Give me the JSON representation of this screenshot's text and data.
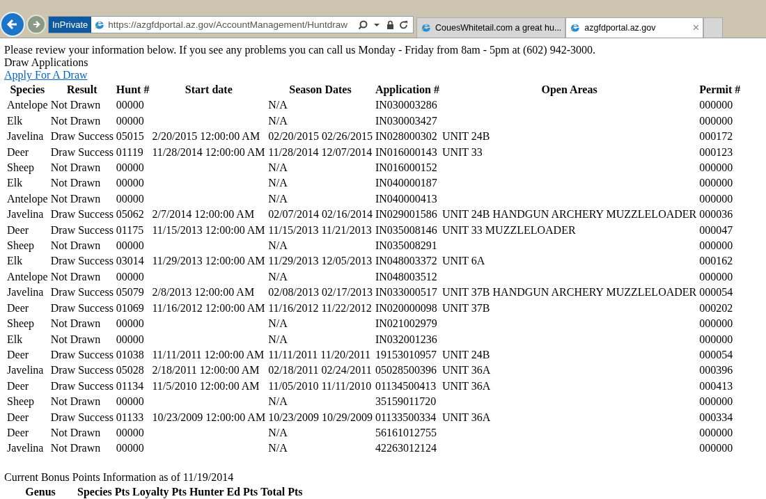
{
  "browser": {
    "private_badge": "InPrivate",
    "address": "https://azgfdportal.az.gov/AccountManagement/Huntdraw",
    "tabs": [
      {
        "title": "CouesWhitetail.com a great hu...",
        "selected": false
      },
      {
        "title": "azgfdportal.az.gov",
        "selected": true,
        "close": "×"
      }
    ]
  },
  "page": {
    "notice": "Please review your information below. If you see any problems you can call us Monday - Friday from 8am - 5pm at (602) 942-3000.",
    "heading": "Draw Applications",
    "link": "Apply For A Draw",
    "table": {
      "columns": [
        "Species",
        "Result",
        "Hunt #",
        "Start date",
        "Season Dates",
        "Application #",
        "Open Areas",
        "Permit #"
      ],
      "rows": [
        {
          "species": "Antelope",
          "result": "Not Drawn",
          "hunt": "00000",
          "season_dates": "N/A",
          "application": "IN030003286",
          "permit": "000000"
        },
        {
          "species": "Elk",
          "result": "Not Drawn",
          "hunt": "00000",
          "season_dates": "N/A",
          "application": "IN030003427",
          "permit": "000000"
        },
        {
          "species": "Javelina",
          "result": "Draw Success",
          "hunt": "05015",
          "start_date": "2/20/2015 12:00:00 AM",
          "season_dates": "02/20/2015 02/26/2015",
          "application": "IN028000302",
          "open_areas": "UNIT 24B",
          "permit": "000172"
        },
        {
          "species": "Deer",
          "result": "Draw Success",
          "hunt": "01119",
          "start_date": "11/28/2014 12:00:00 AM",
          "season_dates": "11/28/2014 12/07/2014",
          "application": "IN016000143",
          "open_areas": "UNIT 33",
          "permit": "000123"
        },
        {
          "species": "Sheep",
          "result": "Not Drawn",
          "hunt": "00000",
          "season_dates": "N/A",
          "application": "IN016000152",
          "permit": "000000"
        },
        {
          "species": "Elk",
          "result": "Not Drawn",
          "hunt": "00000",
          "season_dates": "N/A",
          "application": "IN040000187",
          "permit": "000000"
        },
        {
          "species": "Antelope",
          "result": "Not Drawn",
          "hunt": "00000",
          "season_dates": "N/A",
          "application": "IN040000413",
          "permit": "000000"
        },
        {
          "species": "Javelina",
          "result": "Draw Success",
          "hunt": "05062",
          "start_date": "2/7/2014 12:00:00 AM",
          "season_dates": "02/07/2014 02/16/2014",
          "application": "IN029001586",
          "open_areas": "UNIT 24B HANDGUN ARCHERY MUZZLELOADER",
          "permit": "000036"
        },
        {
          "species": "Deer",
          "result": "Draw Success",
          "hunt": "01175",
          "start_date": "11/15/2013 12:00:00 AM",
          "season_dates": "11/15/2013 11/21/2013",
          "application": "IN035008146",
          "open_areas": "UNIT 33 MUZZLELOADER",
          "permit": "000047"
        },
        {
          "species": "Sheep",
          "result": "Not Drawn",
          "hunt": "00000",
          "season_dates": "N/A",
          "application": "IN035008291",
          "permit": "000000"
        },
        {
          "species": "Elk",
          "result": "Draw Success",
          "hunt": "03014",
          "start_date": "11/29/2013 12:00:00 AM",
          "season_dates": "11/29/2013 12/05/2013",
          "application": "IN048003372",
          "open_areas": "UNIT 6A",
          "permit": "000162"
        },
        {
          "species": "Antelope",
          "result": "Not Drawn",
          "hunt": "00000",
          "season_dates": "N/A",
          "application": "IN048003512",
          "permit": "000000"
        },
        {
          "species": "Javelina",
          "result": "Draw Success",
          "hunt": "05079",
          "start_date": "2/8/2013 12:00:00 AM",
          "season_dates": "02/08/2013 02/17/2013",
          "application": "IN033000517",
          "open_areas": "UNIT 37B HANDGUN ARCHERY MUZZLELOADER",
          "permit": "000054"
        },
        {
          "species": "Deer",
          "result": "Draw Success",
          "hunt": "01069",
          "start_date": "11/16/2012 12:00:00 AM",
          "season_dates": "11/16/2012 11/22/2012",
          "application": "IN020000098",
          "open_areas": "UNIT 37B",
          "permit": "000202"
        },
        {
          "species": "Sheep",
          "result": "Not Drawn",
          "hunt": "00000",
          "season_dates": "N/A",
          "application": "IN021002979",
          "permit": "000000"
        },
        {
          "species": "Elk",
          "result": "Not Drawn",
          "hunt": "00000",
          "season_dates": "N/A",
          "application": "IN032001236",
          "permit": "000000"
        },
        {
          "species": "Deer",
          "result": "Draw Success",
          "hunt": "01038",
          "start_date": "11/11/2011 12:00:00 AM",
          "season_dates": "11/11/2011 11/20/2011",
          "application": "19153010957",
          "open_areas": "UNIT 24B",
          "permit": "000054"
        },
        {
          "species": "Javelina",
          "result": "Draw Success",
          "hunt": "05028",
          "start_date": "2/18/2011 12:00:00 AM",
          "season_dates": "02/18/2011 02/24/2011",
          "application": "05028500396",
          "open_areas": "UNIT 36A",
          "permit": "000396"
        },
        {
          "species": "Deer",
          "result": "Draw Success",
          "hunt": "01134",
          "start_date": "11/5/2010 12:00:00 AM",
          "season_dates": "11/05/2010 11/11/2010",
          "application": "01134500413",
          "open_areas": "UNIT 36A",
          "permit": "000413"
        },
        {
          "species": "Sheep",
          "result": "Not Drawn",
          "hunt": "00000",
          "season_dates": "N/A",
          "application": "35159011720",
          "permit": "000000"
        },
        {
          "species": "Deer",
          "result": "Draw Success",
          "hunt": "01133",
          "start_date": "10/23/2009 12:00:00 AM",
          "season_dates": "10/23/2009 10/29/2009",
          "application": "01133500334",
          "open_areas": "UNIT 36A",
          "permit": "000334"
        },
        {
          "species": "Deer",
          "result": "Not Drawn",
          "hunt": "00000",
          "season_dates": "N/A",
          "application": "56161012755",
          "permit": "000000"
        },
        {
          "species": "Javelina",
          "result": "Not Drawn",
          "hunt": "00000",
          "season_dates": "N/A",
          "application": "42263012124",
          "permit": "000000"
        }
      ]
    },
    "bonus_heading": "Current Bonus Points Information as of 11/19/2014",
    "bonus_table": {
      "columns": [
        "Genus",
        "Species Pts",
        "Loyalty Pts",
        "Hunter Ed Pts",
        "Total Pts"
      ]
    }
  }
}
